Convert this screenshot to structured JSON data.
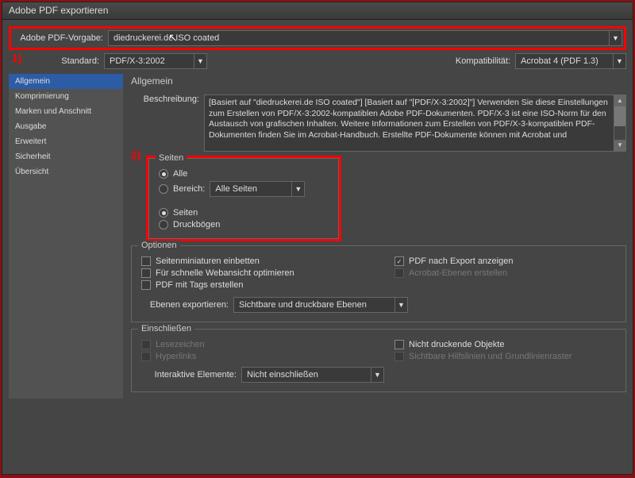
{
  "window": {
    "title": "Adobe PDF exportieren"
  },
  "preset": {
    "label": "Adobe PDF-Vorgabe:",
    "value": "diedruckerei.de ISO coated"
  },
  "standard": {
    "label": "Standard:",
    "value": "PDF/X-3:2002"
  },
  "compat": {
    "label": "Kompatibilität:",
    "value": "Acrobat 4 (PDF 1.3)"
  },
  "annotations": {
    "a1": "1)",
    "a2": "2)"
  },
  "sidebar": {
    "items": [
      {
        "label": "Allgemein"
      },
      {
        "label": "Komprimierung"
      },
      {
        "label": "Marken und Anschnitt"
      },
      {
        "label": "Ausgabe"
      },
      {
        "label": "Erweitert"
      },
      {
        "label": "Sicherheit"
      },
      {
        "label": "Übersicht"
      }
    ]
  },
  "panel": {
    "heading": "Allgemein",
    "description_label": "Beschreibung:",
    "description": "[Basiert auf \"diedruckerei.de ISO coated\"] [Basiert auf \"[PDF/X-3:2002]\"] Verwenden Sie diese Einstellungen zum Erstellen von PDF/X-3:2002-kompatiblen Adobe PDF-Dokumenten. PDF/X-3 ist eine ISO-Norm für den Austausch von grafischen Inhalten. Weitere Informationen zum Erstellen von PDF/X-3-kompatiblen PDF-Dokumenten finden Sie im Acrobat-Handbuch. Erstellte PDF-Dokumente können mit Acrobat und"
  },
  "pages": {
    "legend": "Seiten",
    "all": "Alle",
    "range": "Bereich:",
    "range_value": "Alle Seiten",
    "pages": "Seiten",
    "spreads": "Druckbögen"
  },
  "options": {
    "legend": "Optionen",
    "thumbs": "Seitenminiaturen einbetten",
    "fastweb": "Für schnelle Webansicht optimieren",
    "tagged": "PDF mit Tags erstellen",
    "view": "PDF nach Export anzeigen",
    "layers": "Acrobat-Ebenen erstellen",
    "export_layers_label": "Ebenen exportieren:",
    "export_layers_value": "Sichtbare und druckbare Ebenen"
  },
  "include": {
    "legend": "Einschließen",
    "bookmarks": "Lesezeichen",
    "hyperlinks": "Hyperlinks",
    "nonprint": "Nicht druckende Objekte",
    "guides": "Sichtbare Hilfslinien und Grundlinienraster",
    "interactive_label": "Interaktive Elemente:",
    "interactive_value": "Nicht einschließen"
  }
}
